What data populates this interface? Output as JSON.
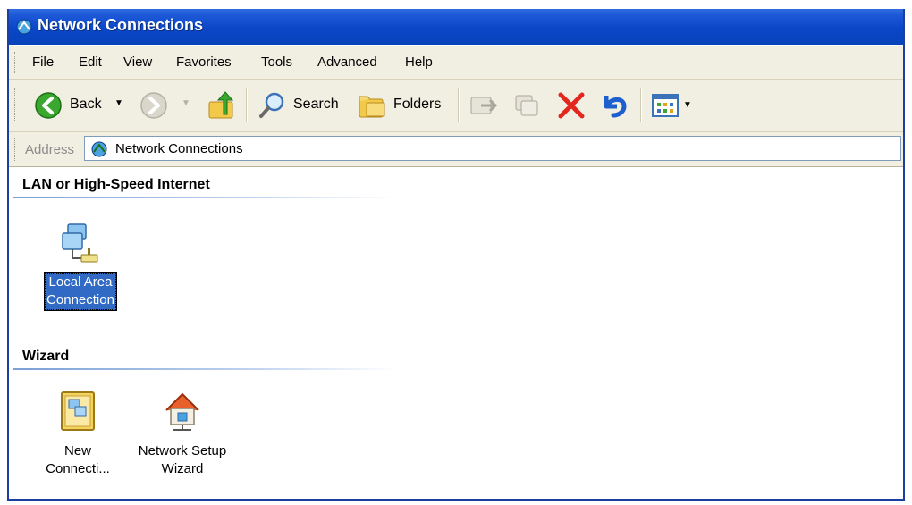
{
  "window": {
    "title": "Network Connections"
  },
  "menu": [
    "File",
    "Edit",
    "View",
    "Favorites",
    "Tools",
    "Advanced",
    "Help"
  ],
  "toolbar": {
    "back_label": "Back",
    "search_label": "Search",
    "folders_label": "Folders"
  },
  "address": {
    "label": "Address",
    "value": "Network Connections"
  },
  "groups": [
    {
      "title": "LAN or High-Speed Internet",
      "items": [
        {
          "label_line1": "Local Area",
          "label_line2": "Connection",
          "selected": true,
          "icon": "lan-connection-icon"
        }
      ]
    },
    {
      "title": "Wizard",
      "items": [
        {
          "label_line1": "New",
          "label_line2": "Connecti...",
          "icon": "new-connection-wizard-icon"
        },
        {
          "label_line1": "Network Setup",
          "label_line2": "Wizard",
          "icon": "network-setup-wizard-icon"
        }
      ]
    }
  ],
  "colors": {
    "titlebar": "#0a46c8",
    "chrome": "#f1efe2",
    "selection": "#316ac5"
  }
}
